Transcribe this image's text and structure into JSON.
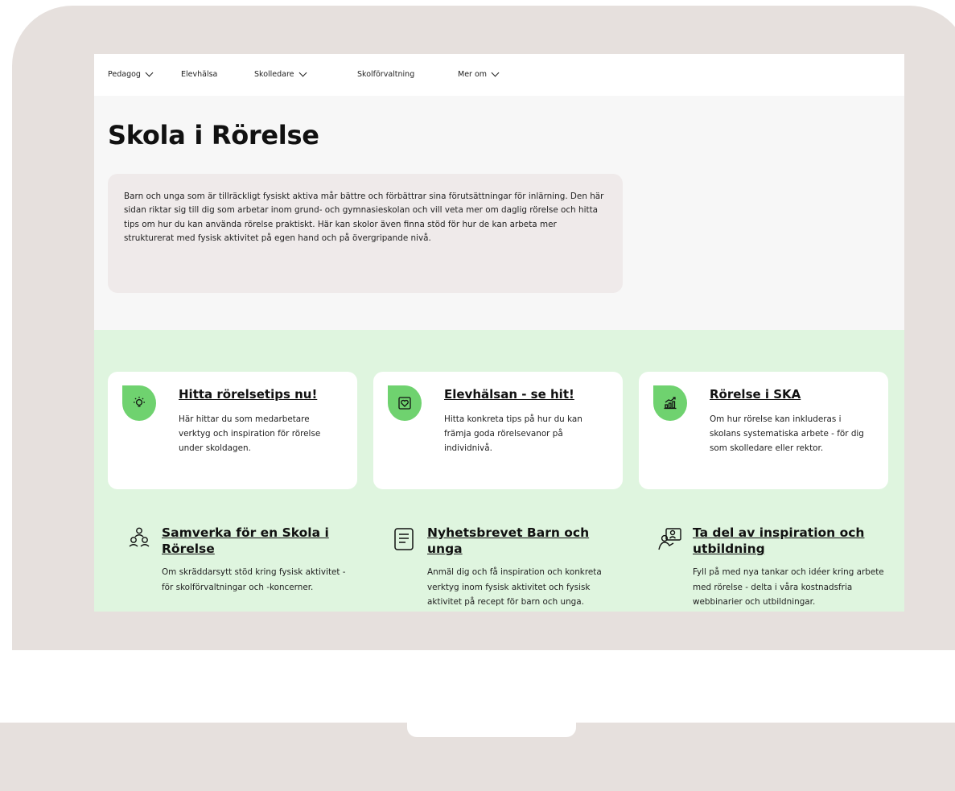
{
  "nav": {
    "items": [
      {
        "label": "Pedagog",
        "dropdown": true
      },
      {
        "label": "Elevhälsa",
        "dropdown": false
      },
      {
        "label": "Skolledare",
        "dropdown": true
      },
      {
        "label": "Skolförvaltning",
        "dropdown": false
      },
      {
        "label": "Mer om",
        "dropdown": true
      }
    ]
  },
  "page": {
    "title": "Skola i Rörelse",
    "intro": "Barn och unga som är tillräckligt fysiskt aktiva mår bättre och förbättrar sina förutsättningar för inlärning. Den här sidan riktar sig till dig som arbetar inom grund- och gymnasieskolan och vill veta mer om daglig rörelse och hitta tips om hur du kan använda rörelse praktiskt. Här kan skolor även finna stöd för hur de kan arbeta mer strukturerat med fysisk aktivitet på egen hand och på övergripande nivå."
  },
  "cards": [
    {
      "title": "Hitta rörelsetips nu!",
      "text": "Här hittar du som medarbetare verktyg och inspiration för rörelse under skoldagen.",
      "icon": "lightbulb-icon"
    },
    {
      "title": "Elevhälsan - se hit!",
      "text": "Hitta konkreta tips på hur du kan främja goda rörelsevanor på individnivå.",
      "icon": "heart-icon"
    },
    {
      "title": "Rörelse i SKA",
      "text": "Om hur rörelse kan inkluderas i skolans systematiska arbete - för dig som skolledare eller rektor.",
      "icon": "chart-growth-icon"
    }
  ],
  "links": [
    {
      "title": "Samverka för en Skola i Rörelse",
      "text": "Om skräddarsytt stöd kring fysisk aktivitet - för skolförvaltningar och -koncerner.",
      "icon": "people-group-icon"
    },
    {
      "title": "Nyhetsbrevet Barn och unga",
      "text": "Anmäl dig och få inspiration och konkreta verktyg inom fysisk aktivitet och fysisk aktivitet på recept för barn och unga.",
      "icon": "document-icon"
    },
    {
      "title": "Ta del av inspiration och utbildning",
      "text": "Fyll på med nya tankar och idéer kring arbete med rörelse - delta i våra kostnadsfria webbinarier och utbildningar.",
      "icon": "presenter-icon"
    }
  ],
  "colors": {
    "device_frame": "#e6e0dd",
    "green_section": "#dff5df",
    "icon_green": "#6fd26f",
    "intro_box": "#efeaea"
  }
}
